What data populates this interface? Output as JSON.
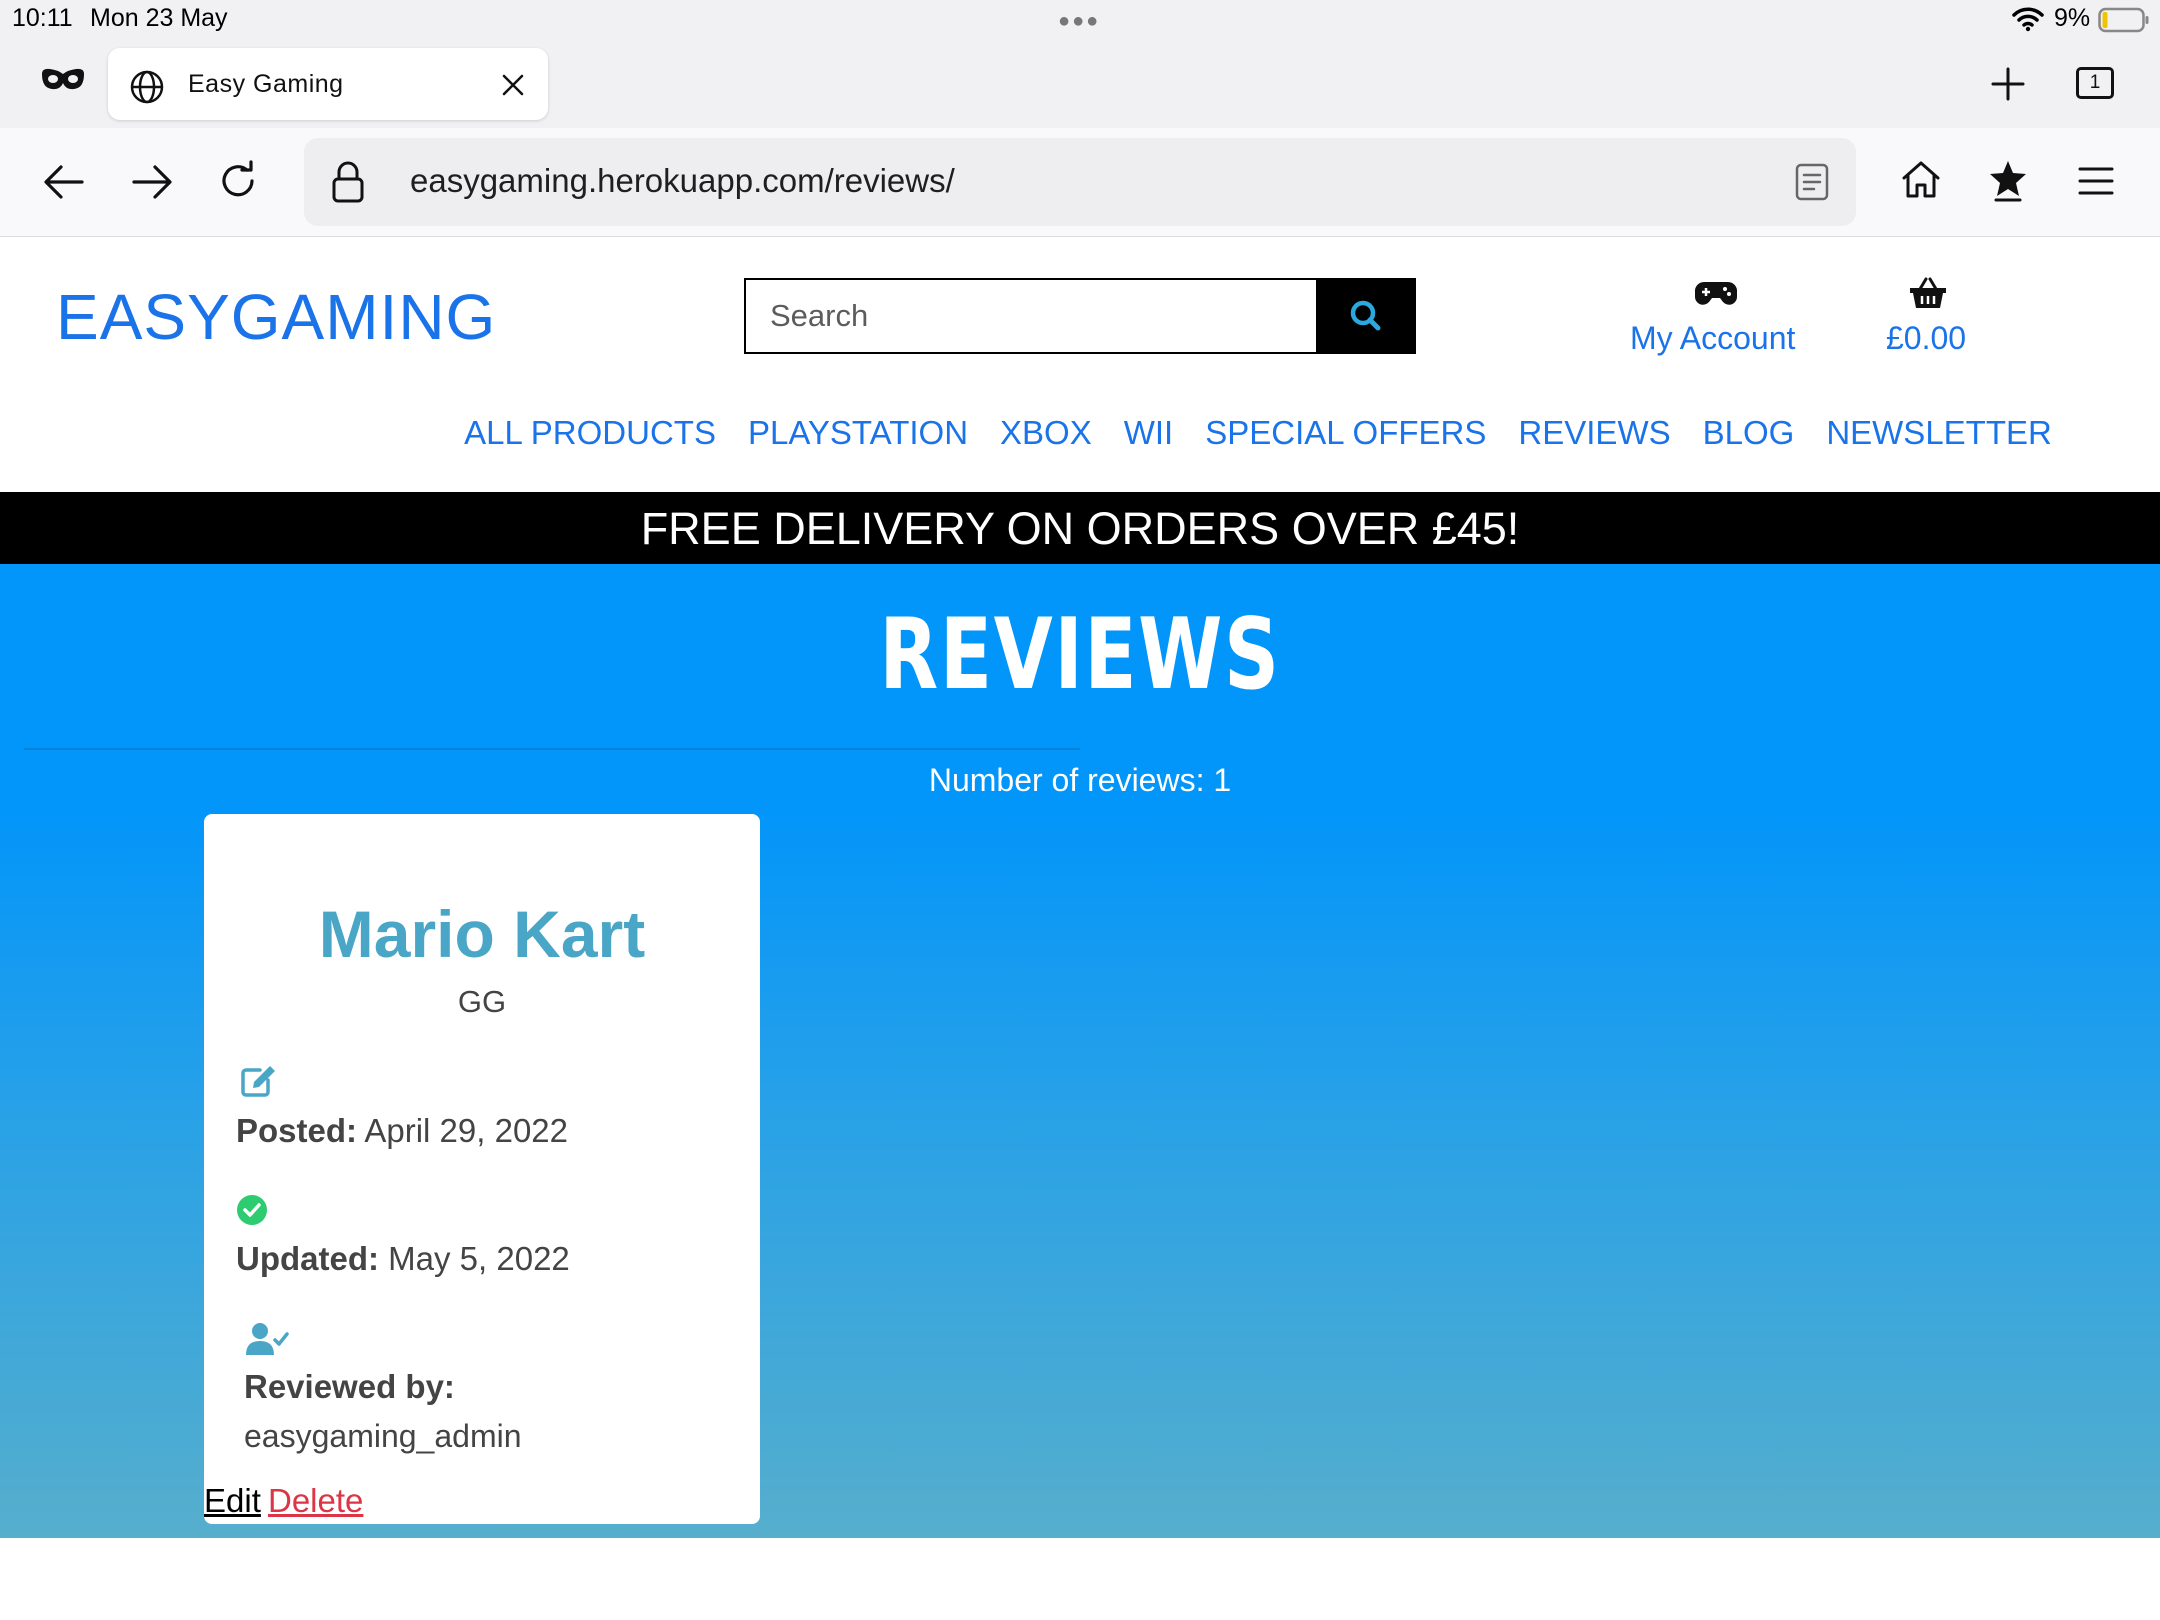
{
  "status_bar": {
    "time": "10:11",
    "date": "Mon 23 May",
    "battery": "9%"
  },
  "browser": {
    "tab_title": "Easy Gaming",
    "tab_count": "1",
    "url": "easygaming.herokuapp.com/reviews/"
  },
  "site": {
    "logo": "EASYGAMING",
    "search_placeholder": "Search",
    "account_label": "My Account",
    "basket_total": "£0.00",
    "nav": [
      "ALL PRODUCTS",
      "PLAYSTATION",
      "XBOX",
      "WII",
      "SPECIAL OFFERS",
      "REVIEWS",
      "BLOG",
      "NEWSLETTER"
    ],
    "banner": "FREE DELIVERY ON ORDERS OVER £45!"
  },
  "page": {
    "title": "REVIEWS",
    "review_count": "Number of reviews: 1"
  },
  "review": {
    "title": "Mario Kart",
    "text": "GG",
    "posted_label": "Posted:",
    "posted_date": "April 29, 2022",
    "updated_label": "Updated:",
    "updated_date": "May 5, 2022",
    "reviewed_by_label": "Reviewed by:",
    "reviewer": "easygaming_admin",
    "edit_label": "Edit",
    "delete_label": "Delete"
  },
  "colors": {
    "brand_blue": "#1a73e8",
    "hero_blue": "#0295fa",
    "card_title": "#4aa6c6",
    "delete_red": "#dc3545",
    "check_green": "#2ecc71"
  }
}
